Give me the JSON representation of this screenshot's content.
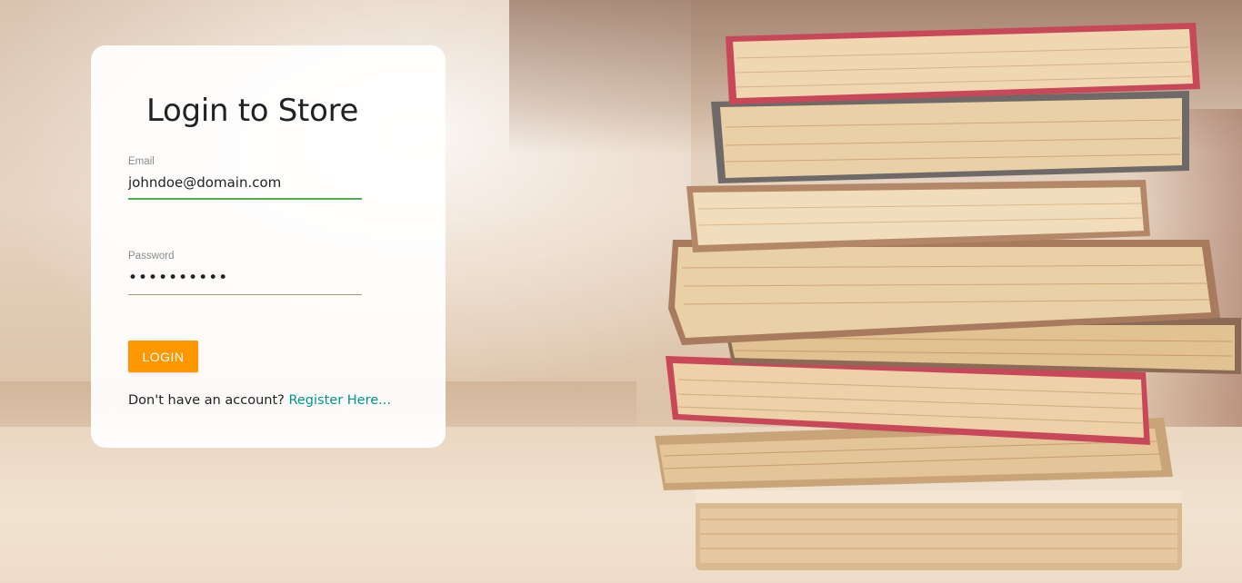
{
  "login_card": {
    "title": "Login to Store",
    "email": {
      "label": "Email",
      "value": "johndoe@domain.com"
    },
    "password": {
      "label": "Password",
      "masked_value": "••••••••••"
    },
    "login_button_label": "LOGIN",
    "register": {
      "prompt": "Don't have an account?",
      "link_text": "Register Here..."
    }
  },
  "colors": {
    "accent_button": "#ff9800",
    "email_underline": "#4caf50",
    "password_underline": "#b0956b",
    "link": "#009688"
  },
  "background": {
    "image_subject": "stack-of-books-photo"
  }
}
